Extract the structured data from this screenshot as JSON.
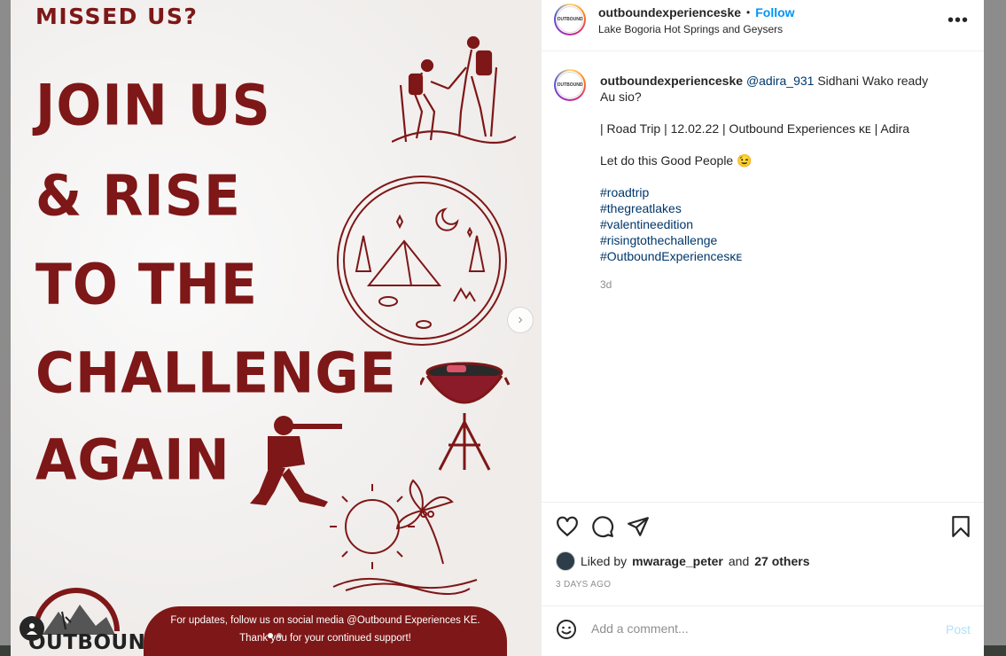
{
  "poster": {
    "missed": "MISSED US?",
    "line1": "JOIN US",
    "line2": "& RISE",
    "line3": "TO THE",
    "line4": "CHALLENGE",
    "line5": "AGAIN",
    "banner_line1": "For updates, follow us on social media @Outbound Experiences KE.",
    "banner_line2": "Thank you for your continued support!",
    "logo_word": "OUTBOUND",
    "carousel_dots": 2,
    "colors": {
      "accent": "#7e1717"
    }
  },
  "header": {
    "username": "outboundexperienceske",
    "separator": "•",
    "follow_label": "Follow",
    "location": "Lake Bogoria Hot Springs and Geysers",
    "avatar_text": "OUTBOUND"
  },
  "caption": {
    "username": "outboundexperienceske",
    "mention": "@adira_931",
    "text1": " Sidhani Wako ready",
    "text2": "Au sio?",
    "text3": "| Road Trip | 12.02.22 | Outbound Experiences ᴋᴇ | Adira",
    "text4": "Let do this Good People 😉",
    "hashtags": [
      "#roadtrip",
      "#thegreatlakes",
      "#valentineedition",
      "#risingtothechallenge",
      "#OutboundExperiencesᴋᴇ"
    ],
    "time": "3d"
  },
  "likes": {
    "prefix": "Liked by",
    "user": "mwarage_peter",
    "middle": "and",
    "others": "27 others"
  },
  "posted_ago": "3 DAYS AGO",
  "comment": {
    "placeholder": "Add a comment...",
    "post_label": "Post"
  },
  "icons": [
    "heart-icon",
    "comment-icon",
    "share-icon",
    "bookmark-icon",
    "emoji-icon",
    "more-icon",
    "chevron-right-icon",
    "user-tag-icon"
  ]
}
